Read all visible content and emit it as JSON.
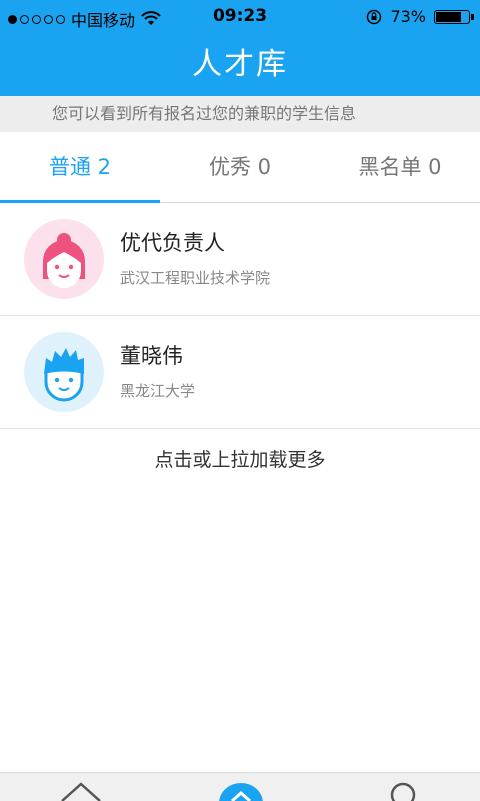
{
  "status_bar": {
    "carrier": "中国移动",
    "time": "09:23",
    "battery_percent": "73%",
    "battery_level": 0.73
  },
  "header": {
    "title": "人才库"
  },
  "notice": {
    "text": "您可以看到所有报名过您的兼职的学生信息"
  },
  "tabs": [
    {
      "label": "普通 2",
      "active": true
    },
    {
      "label": "优秀 0",
      "active": false
    },
    {
      "label": "黑名单 0",
      "active": false
    }
  ],
  "list": [
    {
      "name": "优代负责人",
      "school": "武汉工程职业技术学院",
      "avatar": "girl-avatar-icon"
    },
    {
      "name": "董晓伟",
      "school": "黑龙江大学",
      "avatar": "boy-avatar-icon"
    }
  ],
  "load_more": {
    "label": "点击或上拉加载更多"
  },
  "bottom_nav": {
    "icons": [
      "home-icon",
      "center-home-icon",
      "profile-icon"
    ]
  },
  "colors": {
    "accent": "#1aa3f0",
    "girl_hair": "#f0527f",
    "boy_hair": "#1aa3f0"
  }
}
